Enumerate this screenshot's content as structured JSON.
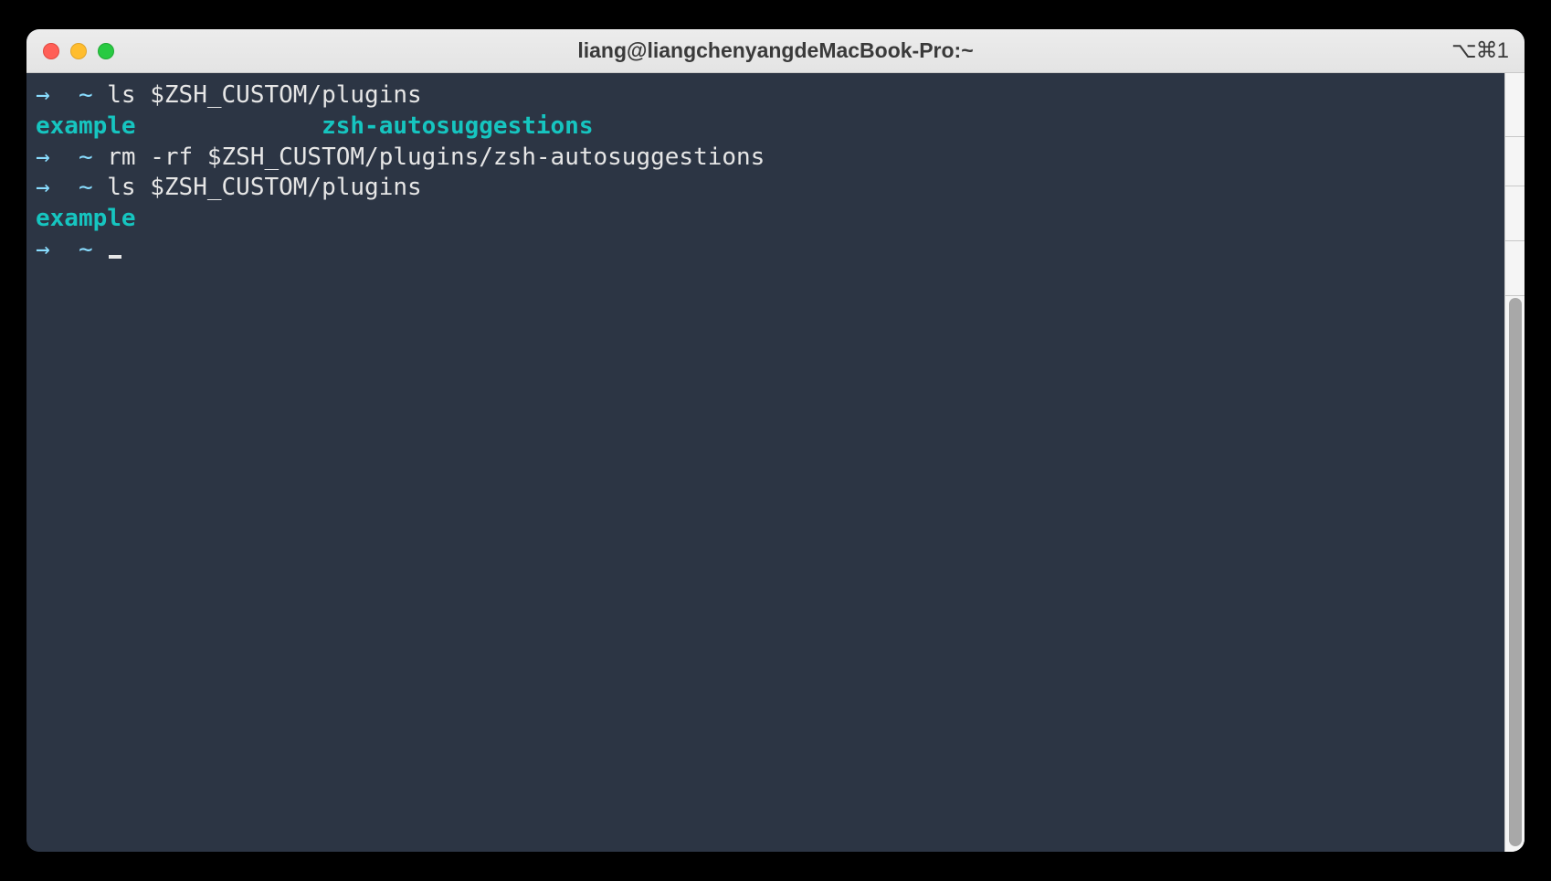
{
  "window": {
    "title": "liang@liangchenyangdeMacBook-Pro:~",
    "shortcut": "⌥⌘1"
  },
  "terminal": {
    "lines": [
      {
        "type": "prompt",
        "arrow": "→",
        "tilde": "~",
        "command": "ls $ZSH_CUSTOM/plugins"
      },
      {
        "type": "output-dirs",
        "col1": "example",
        "col2": "zsh-autosuggestions"
      },
      {
        "type": "prompt",
        "arrow": "→",
        "tilde": "~",
        "command": "rm -rf $ZSH_CUSTOM/plugins/zsh-autosuggestions"
      },
      {
        "type": "prompt",
        "arrow": "→",
        "tilde": "~",
        "command": "ls $ZSH_CUSTOM/plugins"
      },
      {
        "type": "output-dirs",
        "col1": "example",
        "col2": ""
      },
      {
        "type": "prompt-cursor",
        "arrow": "→",
        "tilde": "~"
      }
    ]
  },
  "colors": {
    "bg": "#2C3544",
    "prompt": "#89DDFF",
    "dir": "#16C5C0",
    "text": "#E6E6E6"
  }
}
